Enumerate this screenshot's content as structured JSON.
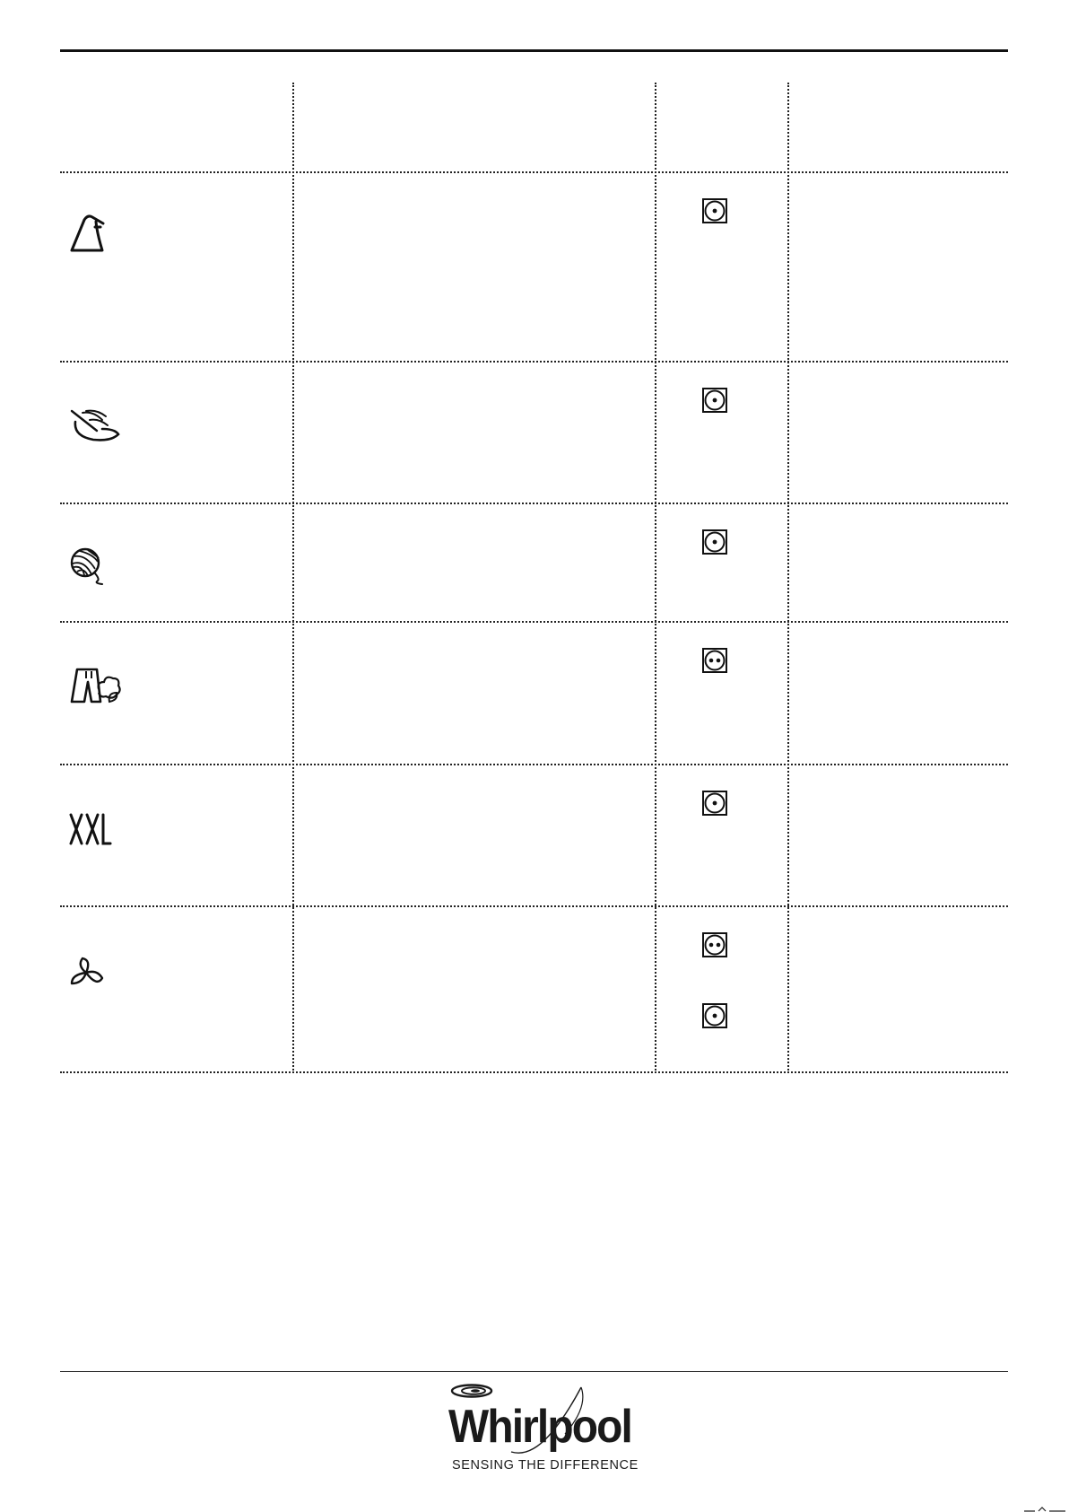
{
  "brand": {
    "name": "Whirlpool",
    "tagline": "SENSING THE DIFFERENCE"
  },
  "table": {
    "rows": [
      {
        "program_icon": "synthetics-iron-icon",
        "dry_symbols": [
          "tumble-dry-low-heat-icon"
        ]
      },
      {
        "program_icon": "delicates-feather-icon",
        "dry_symbols": [
          "tumble-dry-low-heat-icon"
        ]
      },
      {
        "program_icon": "wool-yarn-icon",
        "dry_symbols": [
          "tumble-dry-low-heat-icon"
        ]
      },
      {
        "program_icon": "outdoor-jeans-icon",
        "dry_symbols": [
          "tumble-dry-normal-heat-icon"
        ]
      },
      {
        "program_icon": "xxl-icon",
        "dry_symbols": [
          "tumble-dry-low-heat-icon"
        ]
      },
      {
        "program_icon": "air-fan-icon",
        "dry_symbols": [
          "tumble-dry-normal-heat-icon",
          "tumble-dry-low-heat-icon"
        ]
      }
    ]
  },
  "colors": {
    "ink": "#111111",
    "background": "#ffffff"
  }
}
